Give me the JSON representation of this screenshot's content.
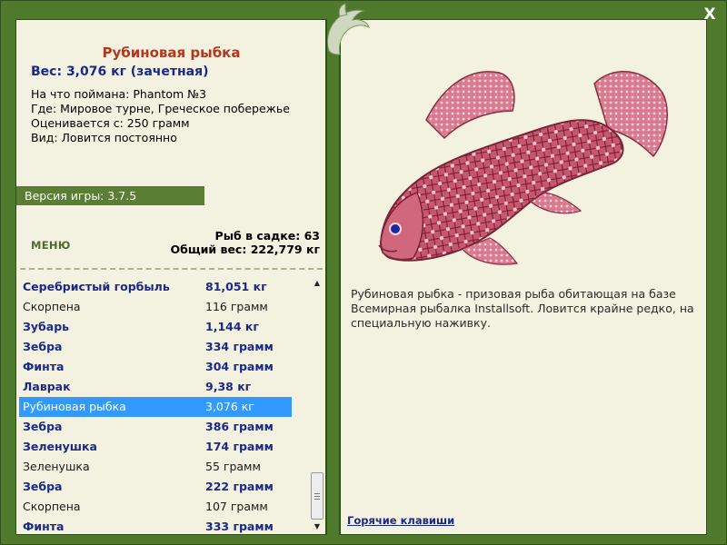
{
  "window": {
    "close_glyph": "X",
    "logo_icon": "dolphin-logo"
  },
  "fish_info": {
    "name": "Рубиновая рыбка",
    "weight_line": "Вес: 3,076 кг (зачетная)",
    "bait_line": "На что поймана: Phantom №3",
    "location_line": "Где: Мировое турне, Греческое побережье",
    "valued_line": "Оценивается с: 250 грамм",
    "type_line": "Вид: Ловится постоянно"
  },
  "version": "Версия игры: 3.7.5",
  "menu_label": "МЕНЮ",
  "stats": {
    "fish_count": "Рыб в садке: 63",
    "total_weight": "Общий вес: 222,779 кг"
  },
  "catch_list": [
    {
      "name": "Серебристый горбыль",
      "weight": "81,051 кг",
      "style": "bold"
    },
    {
      "name": "Скорпена",
      "weight": "116 грамм",
      "style": "plain"
    },
    {
      "name": "Зубарь",
      "weight": "1,144 кг",
      "style": "bold"
    },
    {
      "name": "Зебра",
      "weight": "334 грамм",
      "style": "bold"
    },
    {
      "name": "Финта",
      "weight": "304 грамм",
      "style": "bold"
    },
    {
      "name": "Лаврак",
      "weight": "9,38 кг",
      "style": "bold"
    },
    {
      "name": "Рубиновая рыбка",
      "weight": "3,076 кг",
      "style": "selected"
    },
    {
      "name": "Зебра",
      "weight": "386 грамм",
      "style": "bold"
    },
    {
      "name": "Зеленушка",
      "weight": "174 грамм",
      "style": "bold"
    },
    {
      "name": "Зеленушка",
      "weight": "55 грамм",
      "style": "plain"
    },
    {
      "name": "Зебра",
      "weight": "222 грамм",
      "style": "bold"
    },
    {
      "name": "Скорпена",
      "weight": "107 грамм",
      "style": "plain"
    },
    {
      "name": "Финта",
      "weight": "333 грамм",
      "style": "bold"
    }
  ],
  "description": "Рубиновая рыбка - призовая рыба обитающая на базе Всемирная рыбалка Installsoft. Ловится крайне редко, на специальную наживку.",
  "hotkeys_link": "Горячие клавиши",
  "colors": {
    "frame_green": "#4f7a2e",
    "panel_bg": "#f3f1df",
    "title_red": "#b5371f",
    "value_blue": "#1b2a8a",
    "selection_blue": "#3399ff",
    "version_bar": "#5b7e35",
    "fish_pink": "#c8566e"
  },
  "scroll_position": 0.88
}
